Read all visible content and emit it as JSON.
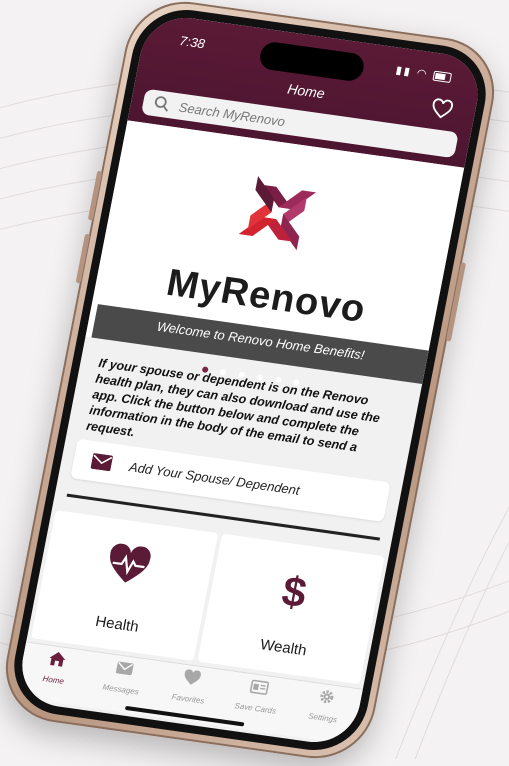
{
  "status": {
    "time": "7:38"
  },
  "header": {
    "title": "Home"
  },
  "search": {
    "placeholder": "Search MyRenovo"
  },
  "hero": {
    "brand": "MyRenovo",
    "banner": "Welcome to Renovo Home Benefits!",
    "slide_count": 6,
    "active_slide": 0
  },
  "info": {
    "text": "If your spouse or dependent is on the Renovo health plan, they can also download and use the app. Click the button below and complete the information in the body of the email to send a request."
  },
  "add_dependent": {
    "label": "Add Your Spouse/ Dependent",
    "icon": "envelope-icon"
  },
  "tiles": [
    {
      "label": "Health",
      "icon": "heart-pulse-icon"
    },
    {
      "label": "Wealth",
      "icon": "dollar-icon"
    }
  ],
  "tabs": [
    {
      "label": "Home",
      "icon": "home-icon",
      "active": true
    },
    {
      "label": "Messages",
      "icon": "envelope-icon",
      "active": false
    },
    {
      "label": "Favorites",
      "icon": "heart-icon",
      "active": false
    },
    {
      "label": "Save Cards",
      "icon": "card-icon",
      "active": false
    },
    {
      "label": "Settings",
      "icon": "gear-icon",
      "active": false
    }
  ],
  "colors": {
    "brand": "#5b1a36",
    "accent_red": "#d3232e",
    "banner": "#4a4a4a"
  }
}
